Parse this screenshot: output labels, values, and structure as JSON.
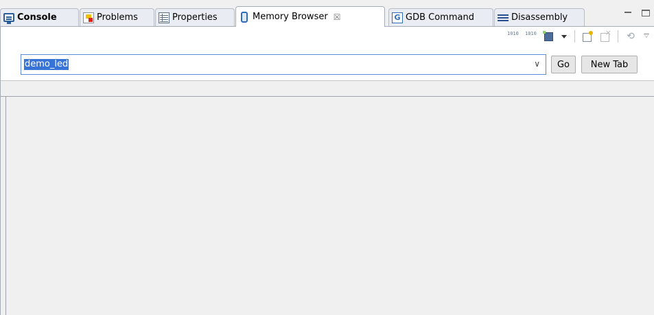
{
  "tabs": [
    {
      "label": "Console",
      "icon": "console-icon",
      "active": false,
      "bold": true
    },
    {
      "label": "Problems",
      "icon": "problems-icon",
      "active": false
    },
    {
      "label": "Properties",
      "icon": "properties-icon",
      "active": false
    },
    {
      "label": "Memory Browser",
      "icon": "memory-icon",
      "active": true,
      "close": "☒"
    },
    {
      "label": "GDB Command",
      "icon": "gdb-icon",
      "icon_text": "G",
      "active": false
    },
    {
      "label": "Disassembly",
      "icon": "disassembly-icon",
      "active": false
    }
  ],
  "toolbar": {
    "bin_a": "1010",
    "bin_b": "1010",
    "sync_glyph": "⟲"
  },
  "address_bar": {
    "value": "demo_led",
    "dropdown_glyph": "∨"
  },
  "buttons": {
    "go": "Go",
    "new_tab": "New Tab"
  },
  "colors": {
    "selection": "#3874d8",
    "focus_border": "#5a8ad8"
  }
}
